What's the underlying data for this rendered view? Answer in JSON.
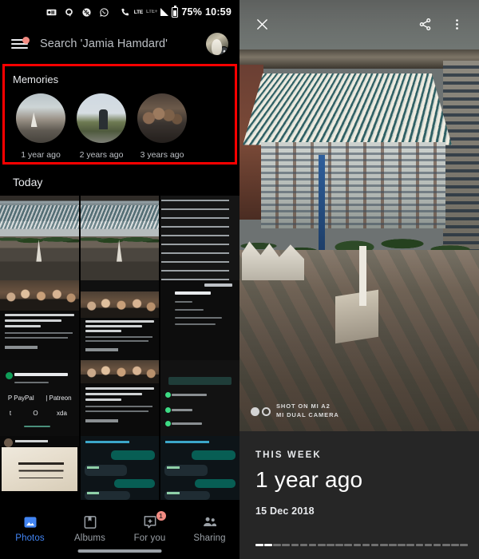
{
  "left_panel": {
    "status_bar": {
      "notification_icons": [
        "voicemail-icon",
        "quora-icon",
        "no-sync-icon",
        "whatsapp-icon"
      ],
      "network_type": "LTE",
      "network_type_secondary": "LTE+",
      "battery_percent": "75%",
      "time": "10:59"
    },
    "search": {
      "menu_icon": "hamburger-menu-icon",
      "menu_badge": true,
      "placeholder": "Search 'Jamia Hamdard'",
      "avatar_badge_icon": "upload-arrow-icon"
    },
    "memories": {
      "title": "Memories",
      "items": [
        {
          "label": "1 year ago",
          "thumb": "courtyard-photo"
        },
        {
          "label": "2 years ago",
          "thumb": "person-on-steps-photo"
        },
        {
          "label": "3 years ago",
          "thumb": "group-selfie-photo"
        }
      ],
      "highlight_color": "#ff0000"
    },
    "today": {
      "header": "Today"
    },
    "grid": {
      "rows": [
        {
          "cells": [
            "courtyard-photo",
            "courtyard-photo",
            "news-text-screenshot"
          ]
        },
        {
          "cells": [
            "news-article-screenshot",
            "news-article-screenshot",
            "magisk-module-screenshot"
          ]
        },
        {
          "cells": [
            "magisk-about-screenshot",
            "news-article-screenshot",
            "magisk-menu-screenshot"
          ]
        },
        {
          "cells": [
            "instagram-post-screenshot",
            "whatsapp-chat-screenshot",
            "whatsapp-chat-screenshot"
          ]
        }
      ]
    },
    "bottom_nav": {
      "items": [
        {
          "label": "Photos",
          "icon": "photos-icon",
          "active": true,
          "badge": ""
        },
        {
          "label": "Albums",
          "icon": "albums-icon",
          "active": false,
          "badge": ""
        },
        {
          "label": "For you",
          "icon": "for-you-icon",
          "active": false,
          "badge": "1"
        },
        {
          "label": "Sharing",
          "icon": "sharing-icon",
          "active": false,
          "badge": ""
        }
      ],
      "active_color": "#4285f4",
      "badge_color": "#f28b82"
    }
  },
  "right_panel": {
    "top_bar": {
      "close_icon": "close-icon",
      "share_icon": "share-icon",
      "more_icon": "more-vertical-icon"
    },
    "photo": {
      "watermark_line1": "SHOT ON MI A2",
      "watermark_line2": "MI DUAL CAMERA",
      "watermark_icon": "dual-lens-icon"
    },
    "info": {
      "kicker": "THIS WEEK",
      "title": "1 year ago",
      "date": "15 Dec 2018"
    },
    "progress": {
      "total_segments": 24,
      "viewed_segments": 2
    }
  }
}
